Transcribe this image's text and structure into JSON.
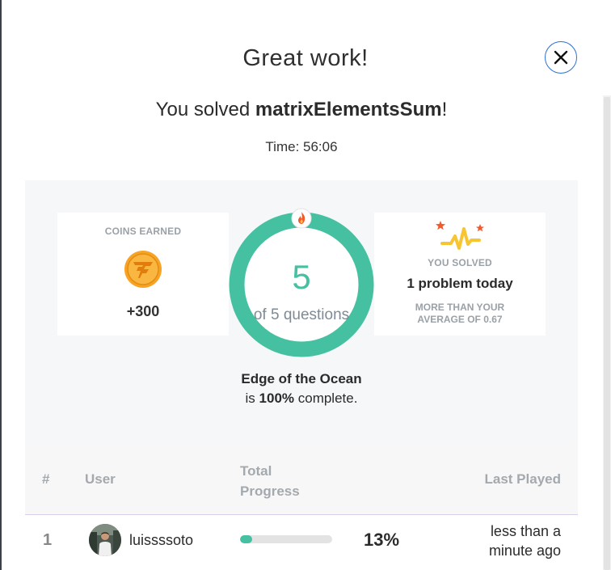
{
  "modal": {
    "title": "Great work!",
    "subtitle_prefix": "You solved ",
    "task_name": "matrixElementsSum",
    "subtitle_suffix": "!",
    "time": "Time: 56:06"
  },
  "coins": {
    "label": "COINS EARNED",
    "value": "+300",
    "icon": "coin-icon"
  },
  "progress_ring": {
    "number": "5",
    "subtitle": "of 5 questions",
    "completed": 5,
    "total": 5,
    "color": "#45c1a1",
    "icon": "flame-icon"
  },
  "solved": {
    "label": "YOU SOLVED",
    "value": "1 problem today",
    "note_line1": "MORE THAN YOUR",
    "note_line2": "AVERAGE OF 0.67",
    "icon": "sparkle-chart-icon"
  },
  "arcade": {
    "name": "Edge of the Ocean",
    "status_prefix": "is ",
    "percent": "100%",
    "status_suffix": " complete."
  },
  "leaderboard": {
    "columns": {
      "rank": "#",
      "user": "User",
      "progress_line1": "Total",
      "progress_line2": "Progress",
      "last_played": "Last Played"
    },
    "rows": [
      {
        "rank": "1",
        "user": "luissssoto",
        "progress_fraction": 0.13,
        "progress_text": "13%",
        "last_played": "less than a minute ago"
      }
    ]
  },
  "colors": {
    "accent": "#45c1a1",
    "close_border": "#2b6fd6",
    "coin": "#f5a623"
  }
}
